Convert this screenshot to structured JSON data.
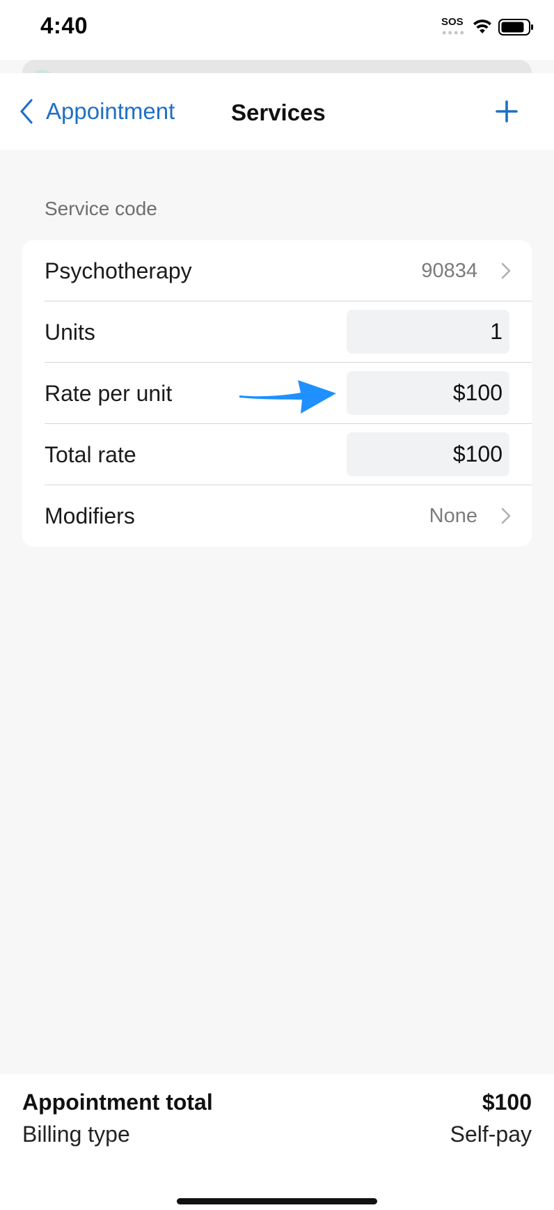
{
  "status_bar": {
    "time": "4:40",
    "sos": "SOS",
    "wifi_icon": "wifi-icon",
    "battery_icon": "battery-icon"
  },
  "nav": {
    "back_label": "Appointment",
    "title": "Services",
    "back_icon": "chevron-left-icon",
    "add_icon": "plus-icon"
  },
  "section": {
    "header": "Service code",
    "rows": [
      {
        "label": "Psychotherapy",
        "value": "90834",
        "type": "disclosure"
      },
      {
        "label": "Units",
        "value": "1",
        "type": "input"
      },
      {
        "label": "Rate per unit",
        "value": "$100",
        "type": "input"
      },
      {
        "label": "Total rate",
        "value": "$100",
        "type": "input"
      },
      {
        "label": "Modifiers",
        "value": "None",
        "type": "disclosure"
      }
    ]
  },
  "annotation": {
    "icon": "arrow-right-icon",
    "color": "#1E90FF"
  },
  "footer": {
    "total_label": "Appointment total",
    "total_value": "$100",
    "billing_label": "Billing type",
    "billing_value": "Self-pay"
  },
  "colors": {
    "accent": "#1F6FC5",
    "background": "#F7F7F7",
    "card": "#FFFFFF",
    "input_fill": "#F1F2F4"
  }
}
